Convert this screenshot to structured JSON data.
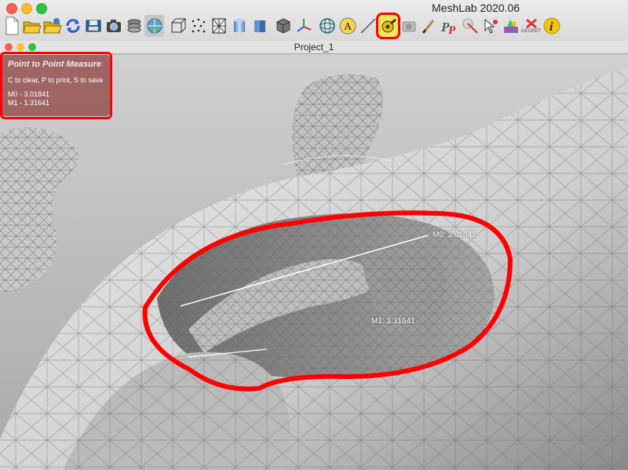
{
  "window": {
    "app_title": "MeshLab 2020.06",
    "project_title": "Project_1"
  },
  "toolbar": {
    "icons": [
      "new-document-icon",
      "open-folder-icon",
      "open-project-icon",
      "reload-icon",
      "save-icon",
      "snapshot-icon",
      "layers-icon",
      "globe-view-icon",
      "bbox-icon",
      "points-icon",
      "wireframe-icon",
      "smooth-icon",
      "flat-icon",
      "lighting-cube-icon",
      "axis-icon",
      "trackball-icon",
      "annotation-a-icon",
      "select-icon",
      "measure-tape-icon",
      "snapshot-camera-icon",
      "paint-brush-icon",
      "pickpoints-icon",
      "edit-align-icon",
      "select-vertex-icon",
      "paint-vertex-icon",
      "georef-icon",
      "info-icon"
    ],
    "georef_label": "GEOREF",
    "info_label": "i",
    "annotation_label": "A"
  },
  "measure_panel": {
    "title": "Point to Point Measure",
    "instructions": "C to clear, P to print, S to save",
    "m0": "M0 - 3.01841",
    "m1": "M1 - 1.31641"
  },
  "measurements": {
    "m0_label": "M0: 3.01841",
    "m1_label": "M1: 1.31641"
  },
  "colors": {
    "highlight": "#ff0000",
    "panel": "#965252",
    "mesh": "#d9d9d9"
  }
}
